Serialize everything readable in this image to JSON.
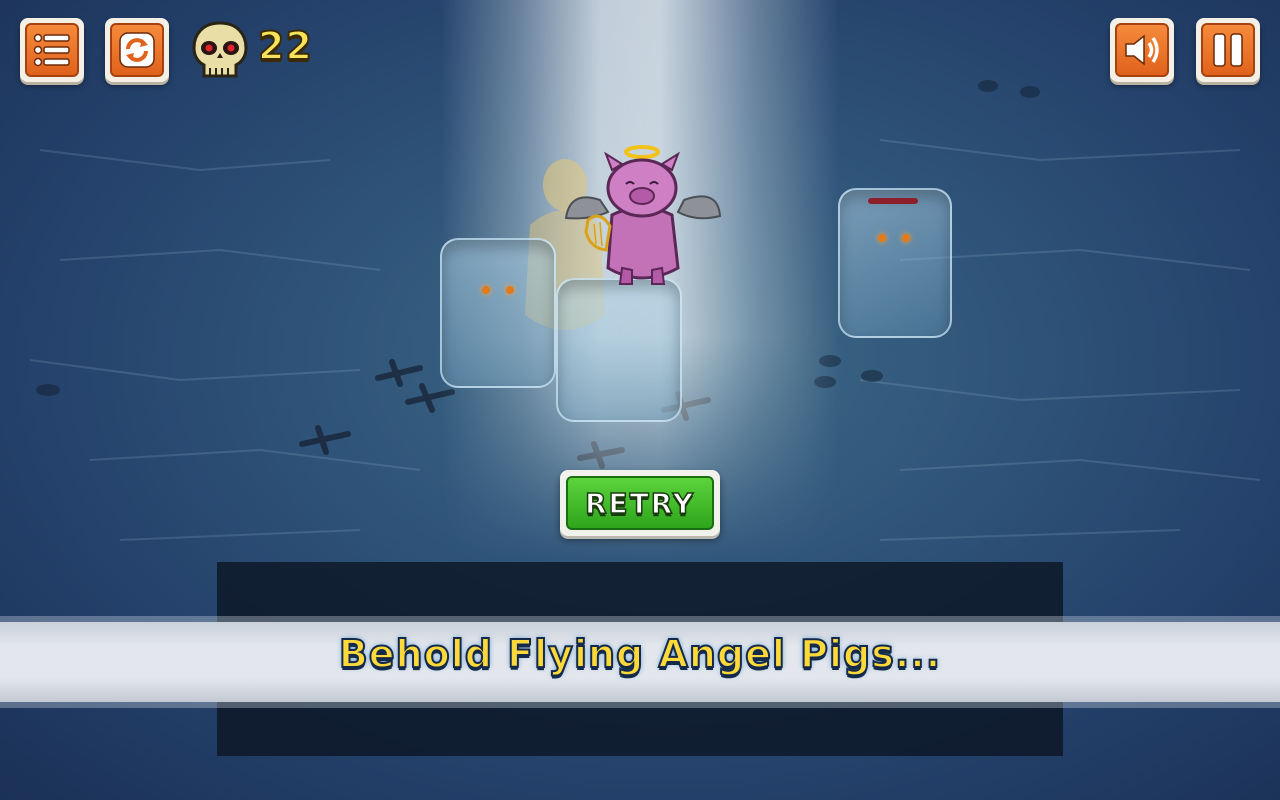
{
  "hud": {
    "menu_icon": "list-menu-icon",
    "restart_icon": "restart-arrows-icon",
    "kill_icon": "skull-red-eyes-icon",
    "kill_count": "22",
    "sound_icon": "speaker-icon",
    "pause_icon": "pause-icon"
  },
  "scene": {
    "hero": "angel-pig-with-halo-wings-harp",
    "frozen_enemies": 3,
    "enemy_health_fraction": 1.0
  },
  "retry_button": {
    "label": "RETRY"
  },
  "caption": {
    "text": "Behold Flying Angel Pigs..."
  },
  "colors": {
    "hud_button_orange": "#e86f27",
    "retry_green": "#3fbe28",
    "counter_yellow": "#f7e35a",
    "caption_yellow": "#ffd83a",
    "background_blue": "#2c4d72"
  }
}
